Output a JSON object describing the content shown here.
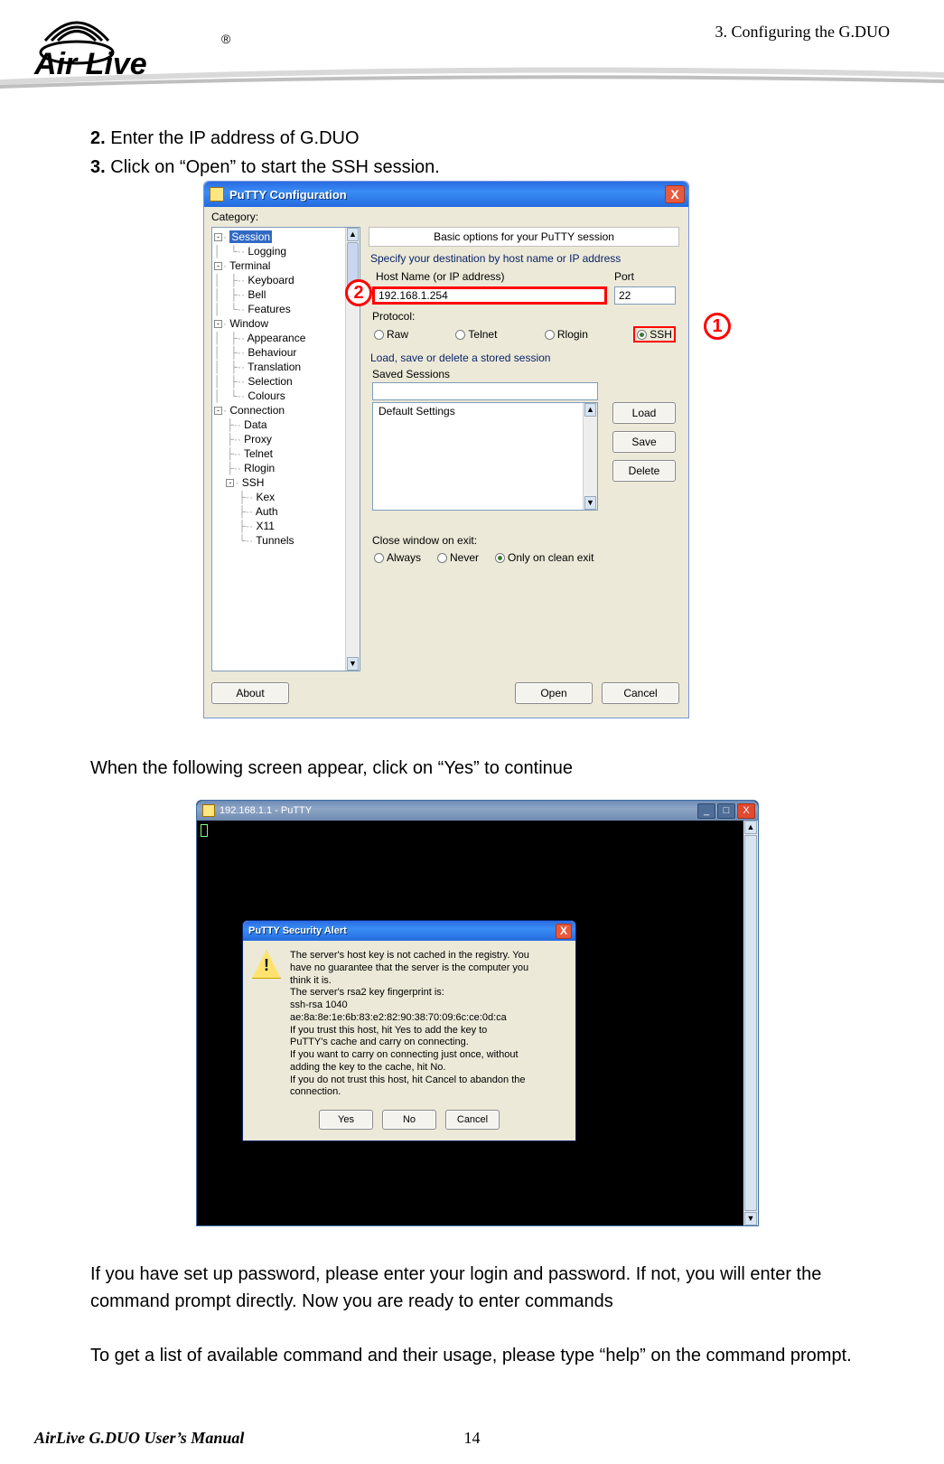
{
  "page": {
    "header_right": "3.  Configuring  the  G.DUO",
    "step2_bold": "2.",
    "step2_text": " Enter the IP address of G.DUO",
    "step3_bold": "3.",
    "step3_text": " Click on “Open” to start the SSH session.",
    "mid_text": "When the following screen appear, click on “Yes” to continue",
    "para1": "If you have set up password, please enter your login and password.    If not, you will enter the command prompt directly.    Now you are ready to enter commands",
    "para2": "To get a list of available command and their usage, please type “help” on the command prompt.",
    "footer_left": "AirLive G.DUO User’s Manual",
    "footer_page": "14",
    "logo_text": "Air Live",
    "logo_r": "®"
  },
  "callouts": {
    "c1": "1",
    "c2": "2"
  },
  "putty_config": {
    "title": "PuTTY Configuration",
    "category_label": "Category:",
    "right_title": "Basic options for your PuTTY session",
    "section_dest": "Specify your destination by host name or IP address",
    "host_label": "Host Name (or IP address)",
    "port_label": "Port",
    "host_value": "192.168.1.254",
    "port_value": "22",
    "protocol_label": "Protocol:",
    "proto_raw": "Raw",
    "proto_telnet": "Telnet",
    "proto_rlogin": "Rlogin",
    "proto_ssh": "SSH",
    "section_sessions": "Load, save or delete a stored session",
    "saved_label": "Saved Sessions",
    "default_settings": "Default Settings",
    "btn_load": "Load",
    "btn_save": "Save",
    "btn_delete": "Delete",
    "close_label": "Close window on exit:",
    "close_always": "Always",
    "close_never": "Never",
    "close_clean": "Only on clean exit",
    "btn_about": "About",
    "btn_open": "Open",
    "btn_cancel": "Cancel",
    "tree": {
      "session": "Session",
      "logging": "Logging",
      "terminal": "Terminal",
      "keyboard": "Keyboard",
      "bell": "Bell",
      "features": "Features",
      "window": "Window",
      "appearance": "Appearance",
      "behaviour": "Behaviour",
      "translation": "Translation",
      "selection": "Selection",
      "colours": "Colours",
      "connection": "Connection",
      "data": "Data",
      "proxy": "Proxy",
      "telnet": "Telnet",
      "rlogin": "Rlogin",
      "ssh": "SSH",
      "kex": "Kex",
      "auth": "Auth",
      "x11": "X11",
      "tunnels": "Tunnels"
    }
  },
  "terminal": {
    "title": "192.168.1.1 - PuTTY",
    "min": "_",
    "max": "□",
    "close": "X"
  },
  "alert": {
    "title": "PuTTY Security Alert",
    "line1": "The server's host key is not cached in the registry. You",
    "line2": "have no guarantee that the server is the computer you",
    "line3": "think it is.",
    "line4": "The server's rsa2 key fingerprint is:",
    "line5": "ssh-rsa 1040 ae:8a:8e:1e:6b:83:e2:82:90:38:70:09:6c:ce:0d:ca",
    "line6": "If you trust this host, hit Yes to add the key to",
    "line7": "PuTTY's cache and carry on connecting.",
    "line8": "If you want to carry on connecting just once, without",
    "line9": "adding the key to the cache, hit No.",
    "line10": "If you do not trust this host, hit Cancel to abandon the",
    "line11": "connection.",
    "btn_yes": "Yes",
    "btn_no": "No",
    "btn_cancel": "Cancel"
  }
}
